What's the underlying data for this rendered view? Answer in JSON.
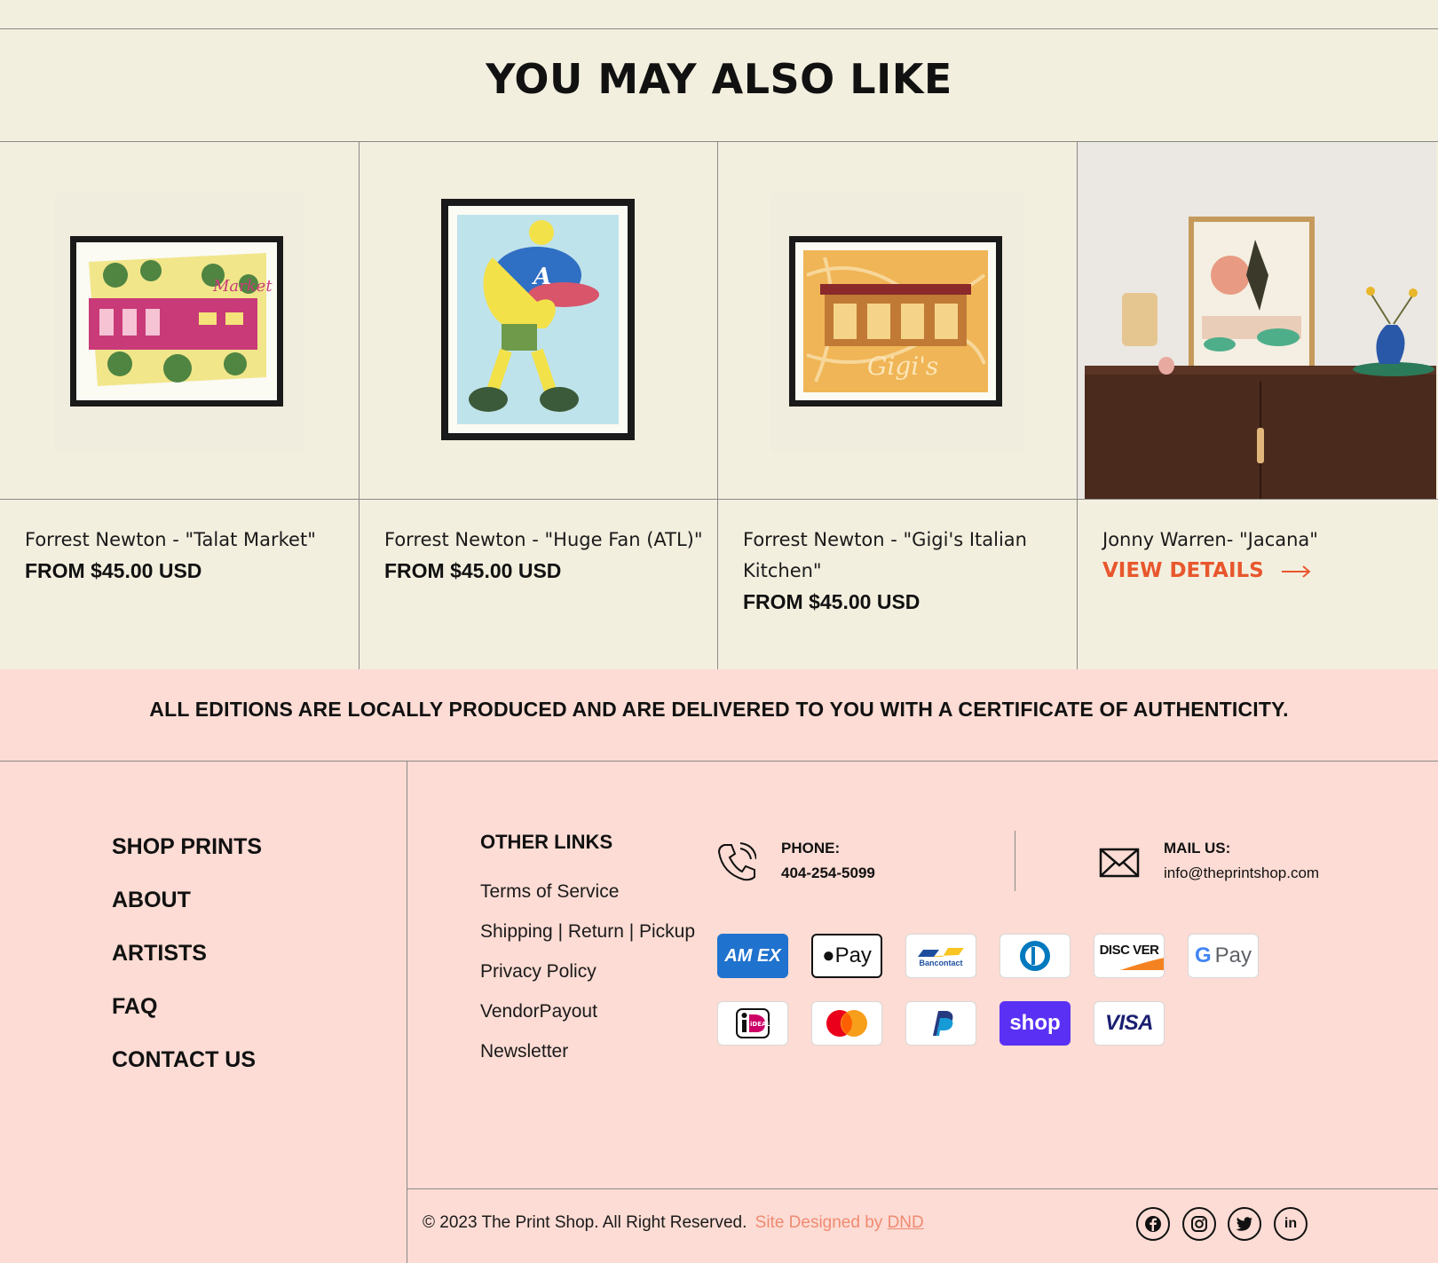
{
  "section": {
    "heading": "YOU MAY ALSO LIKE"
  },
  "products": [
    {
      "title": "Forrest Newton - \"Talat Market\"",
      "price": "FROM $45.00 USD"
    },
    {
      "title": "Forrest Newton - \"Huge Fan (ATL)\"",
      "price": "FROM $45.00 USD"
    },
    {
      "title": "Forrest Newton - \"Gigi's Italian Kitchen\"",
      "price": "FROM $45.00 USD"
    },
    {
      "title": "Jonny Warren- \"Jacana\"",
      "cta": "VIEW DETAILS"
    }
  ],
  "banner": {
    "text": "ALL EDITIONS ARE LOCALLY PRODUCED AND ARE DELIVERED TO YOU WITH A CERTIFICATE OF AUTHENTICITY."
  },
  "footer_nav": [
    "SHOP PRINTS",
    "ABOUT",
    "ARTISTS",
    "FAQ",
    "CONTACT US"
  ],
  "other_links": {
    "heading": "OTHER LINKS",
    "items": [
      "Terms of Service",
      "Shipping | Return | Pickup",
      "Privacy Policy",
      "VendorPayout",
      "Newsletter"
    ]
  },
  "contact": {
    "phone_label": "PHONE:",
    "phone": "404-254-5099",
    "mail_label": "MAIL US:",
    "mail": "info@theprintshop.com"
  },
  "payments": [
    "AMEX",
    "Apple Pay",
    "Bancontact",
    "Diners Club",
    "DISCOVER",
    "G Pay",
    "iDEAL",
    "Mastercard",
    "PayPal",
    "shop",
    "VISA"
  ],
  "payment_labels": {
    "amex": "AM EX",
    "applepay": "Pay",
    "bancontact": "Bancontact",
    "discover": "DISC VER",
    "gpay": "Pay",
    "ideal": "iDEAL",
    "shop": "shop",
    "visa": "VISA"
  },
  "copyright": {
    "text": "© 2023 The Print Shop. All Right Reserved.",
    "designed": "Site Designed by",
    "designer": "DND"
  },
  "social": [
    "facebook",
    "instagram",
    "twitter",
    "linkedin"
  ],
  "colors": {
    "accent": "#e8572d",
    "cream": "#f3efdf",
    "pink": "#fcdcd4",
    "designed_by": "#f08a72",
    "shop_purple": "#5a31f4"
  }
}
